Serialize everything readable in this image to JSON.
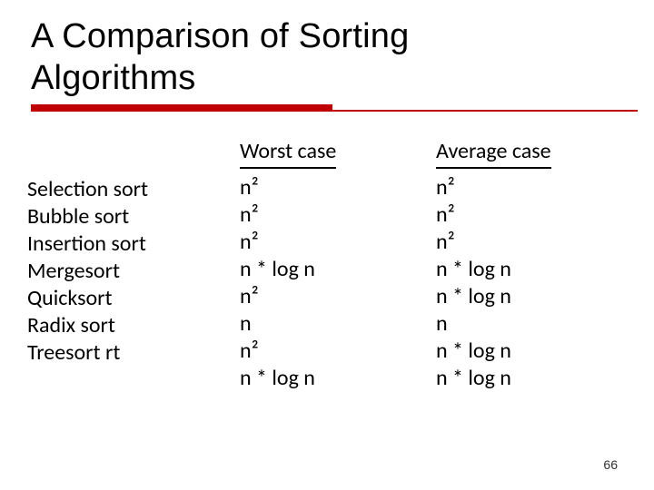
{
  "title_line1": "A Comparison of Sorting",
  "title_line2": "Algorithms",
  "headers": {
    "worst": "Worst case",
    "average": "Average case"
  },
  "algorithms": [
    "Selection sort",
    "Bubble sort",
    "Insertion sort",
    "Mergesort",
    "Quicksort",
    "Radix sort",
    "Treesort rt"
  ],
  "worst": [
    "n²",
    "n²",
    "n²",
    "n * log n",
    "n²",
    "n",
    "n²",
    "n * log n"
  ],
  "average": [
    "n²",
    "n²",
    "n²",
    "n * log n",
    "n * log n",
    "n",
    "n * log n",
    "n * log n"
  ],
  "page_number": "66"
}
